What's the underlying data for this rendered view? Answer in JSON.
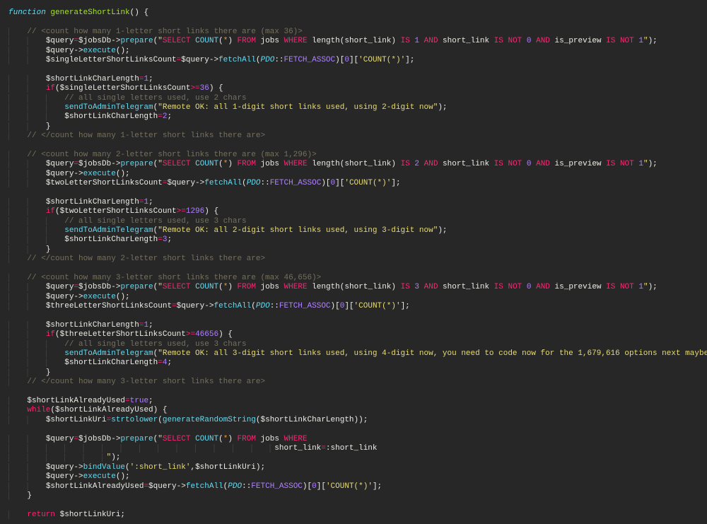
{
  "code": {
    "lines": [
      [
        [
          "i",
          "function"
        ],
        [
          "t",
          " "
        ],
        [
          "g",
          "generateShortLink"
        ],
        [
          "t",
          "() {"
        ]
      ],
      [],
      [
        [
          "ws",
          "    "
        ],
        [
          "m",
          "// <count how many 1-letter short links there are (max 36)>"
        ]
      ],
      [
        [
          "ws",
          "        "
        ],
        [
          "t",
          "$query"
        ],
        [
          "k",
          "="
        ],
        [
          "t",
          "$jobsDb->"
        ],
        [
          "c",
          "prepare"
        ],
        [
          "t",
          "("
        ],
        [
          "s",
          "\""
        ],
        [
          "k",
          "SELECT"
        ],
        [
          "t",
          " "
        ],
        [
          "c",
          "COUNT"
        ],
        [
          "t",
          "("
        ],
        [
          "o",
          "*"
        ],
        [
          "t",
          ") "
        ],
        [
          "k",
          "FROM"
        ],
        [
          "t",
          " jobs "
        ],
        [
          "k",
          "WHERE"
        ],
        [
          "t",
          " length(short_link) "
        ],
        [
          "k",
          "IS"
        ],
        [
          "t",
          " "
        ],
        [
          "n",
          "1"
        ],
        [
          "t",
          " "
        ],
        [
          "k",
          "AND"
        ],
        [
          "t",
          " short_link "
        ],
        [
          "k",
          "IS NOT"
        ],
        [
          "t",
          " "
        ],
        [
          "n",
          "0"
        ],
        [
          "t",
          " "
        ],
        [
          "k",
          "AND"
        ],
        [
          "t",
          " is_preview "
        ],
        [
          "k",
          "IS NOT"
        ],
        [
          "t",
          " "
        ],
        [
          "n",
          "1"
        ],
        [
          "s",
          "\""
        ],
        [
          "t",
          ");"
        ]
      ],
      [
        [
          "ws",
          "        "
        ],
        [
          "t",
          "$query->"
        ],
        [
          "c",
          "execute"
        ],
        [
          "t",
          "();"
        ]
      ],
      [
        [
          "ws",
          "        "
        ],
        [
          "t",
          "$singleLetterShortLinksCount"
        ],
        [
          "k",
          "="
        ],
        [
          "t",
          "$query->"
        ],
        [
          "c",
          "fetchAll"
        ],
        [
          "t",
          "("
        ],
        [
          "i",
          "PDO"
        ],
        [
          "t",
          "::"
        ],
        [
          "p",
          "FETCH_ASSOC"
        ],
        [
          "t",
          ")["
        ],
        [
          "n",
          "0"
        ],
        [
          "t",
          "]["
        ],
        [
          "s",
          "'COUNT(*)'"
        ],
        [
          "t",
          "];"
        ]
      ],
      [],
      [
        [
          "ws",
          "        "
        ],
        [
          "t",
          "$shortLinkCharLength"
        ],
        [
          "k",
          "="
        ],
        [
          "n",
          "1"
        ],
        [
          "t",
          ";"
        ]
      ],
      [
        [
          "ws",
          "        "
        ],
        [
          "k",
          "if"
        ],
        [
          "t",
          "($singleLetterShortLinksCount"
        ],
        [
          "k",
          ">="
        ],
        [
          "n",
          "36"
        ],
        [
          "t",
          ") {"
        ]
      ],
      [
        [
          "ws",
          "            "
        ],
        [
          "m",
          "// all single letters used, use 2 chars"
        ]
      ],
      [
        [
          "ws",
          "            "
        ],
        [
          "c",
          "sendToAdminTelegram"
        ],
        [
          "t",
          "("
        ],
        [
          "s",
          "\"Remote OK: all 1-digit short links used, using 2-digit now\""
        ],
        [
          "t",
          ");"
        ]
      ],
      [
        [
          "ws",
          "            "
        ],
        [
          "t",
          "$shortLinkCharLength"
        ],
        [
          "k",
          "="
        ],
        [
          "n",
          "2"
        ],
        [
          "t",
          ";"
        ]
      ],
      [
        [
          "ws",
          "        "
        ],
        [
          "t",
          "}"
        ]
      ],
      [
        [
          "ws",
          "    "
        ],
        [
          "m",
          "// </count how many 1-letter short links there are>"
        ]
      ],
      [],
      [
        [
          "ws",
          "    "
        ],
        [
          "m",
          "// <count how many 2-letter short links there are (max 1,296)>"
        ]
      ],
      [
        [
          "ws",
          "        "
        ],
        [
          "t",
          "$query"
        ],
        [
          "k",
          "="
        ],
        [
          "t",
          "$jobsDb->"
        ],
        [
          "c",
          "prepare"
        ],
        [
          "t",
          "("
        ],
        [
          "s",
          "\""
        ],
        [
          "k",
          "SELECT"
        ],
        [
          "t",
          " "
        ],
        [
          "c",
          "COUNT"
        ],
        [
          "t",
          "("
        ],
        [
          "o",
          "*"
        ],
        [
          "t",
          ") "
        ],
        [
          "k",
          "FROM"
        ],
        [
          "t",
          " jobs "
        ],
        [
          "k",
          "WHERE"
        ],
        [
          "t",
          " length(short_link) "
        ],
        [
          "k",
          "IS"
        ],
        [
          "t",
          " "
        ],
        [
          "n",
          "2"
        ],
        [
          "t",
          " "
        ],
        [
          "k",
          "AND"
        ],
        [
          "t",
          " short_link "
        ],
        [
          "k",
          "IS NOT"
        ],
        [
          "t",
          " "
        ],
        [
          "n",
          "0"
        ],
        [
          "t",
          " "
        ],
        [
          "k",
          "AND"
        ],
        [
          "t",
          " is_preview "
        ],
        [
          "k",
          "IS NOT"
        ],
        [
          "t",
          " "
        ],
        [
          "n",
          "1"
        ],
        [
          "s",
          "\""
        ],
        [
          "t",
          ");"
        ]
      ],
      [
        [
          "ws",
          "        "
        ],
        [
          "t",
          "$query->"
        ],
        [
          "c",
          "execute"
        ],
        [
          "t",
          "();"
        ]
      ],
      [
        [
          "ws",
          "        "
        ],
        [
          "t",
          "$twoLetterShortLinksCount"
        ],
        [
          "k",
          "="
        ],
        [
          "t",
          "$query->"
        ],
        [
          "c",
          "fetchAll"
        ],
        [
          "t",
          "("
        ],
        [
          "i",
          "PDO"
        ],
        [
          "t",
          "::"
        ],
        [
          "p",
          "FETCH_ASSOC"
        ],
        [
          "t",
          ")["
        ],
        [
          "n",
          "0"
        ],
        [
          "t",
          "]["
        ],
        [
          "s",
          "'COUNT(*)'"
        ],
        [
          "t",
          "];"
        ]
      ],
      [],
      [
        [
          "ws",
          "        "
        ],
        [
          "t",
          "$shortLinkCharLength"
        ],
        [
          "k",
          "="
        ],
        [
          "n",
          "1"
        ],
        [
          "t",
          ";"
        ]
      ],
      [
        [
          "ws",
          "        "
        ],
        [
          "k",
          "if"
        ],
        [
          "t",
          "($twoLetterShortLinksCount"
        ],
        [
          "k",
          ">="
        ],
        [
          "n",
          "1296"
        ],
        [
          "t",
          ") {"
        ]
      ],
      [
        [
          "ws",
          "            "
        ],
        [
          "m",
          "// all single letters used, use 3 chars"
        ]
      ],
      [
        [
          "ws",
          "            "
        ],
        [
          "c",
          "sendToAdminTelegram"
        ],
        [
          "t",
          "("
        ],
        [
          "s",
          "\"Remote OK: all 2-digit short links used, using 3-digit now\""
        ],
        [
          "t",
          ");"
        ]
      ],
      [
        [
          "ws",
          "            "
        ],
        [
          "t",
          "$shortLinkCharLength"
        ],
        [
          "k",
          "="
        ],
        [
          "n",
          "3"
        ],
        [
          "t",
          ";"
        ]
      ],
      [
        [
          "ws",
          "        "
        ],
        [
          "t",
          "}"
        ]
      ],
      [
        [
          "ws",
          "    "
        ],
        [
          "m",
          "// </count how many 2-letter short links there are>"
        ]
      ],
      [],
      [
        [
          "ws",
          "    "
        ],
        [
          "m",
          "// <count how many 3-letter short links there are (max 46,656)>"
        ]
      ],
      [
        [
          "ws",
          "        "
        ],
        [
          "t",
          "$query"
        ],
        [
          "k",
          "="
        ],
        [
          "t",
          "$jobsDb->"
        ],
        [
          "c",
          "prepare"
        ],
        [
          "t",
          "("
        ],
        [
          "s",
          "\""
        ],
        [
          "k",
          "SELECT"
        ],
        [
          "t",
          " "
        ],
        [
          "c",
          "COUNT"
        ],
        [
          "t",
          "("
        ],
        [
          "o",
          "*"
        ],
        [
          "t",
          ") "
        ],
        [
          "k",
          "FROM"
        ],
        [
          "t",
          " jobs "
        ],
        [
          "k",
          "WHERE"
        ],
        [
          "t",
          " length(short_link) "
        ],
        [
          "k",
          "IS"
        ],
        [
          "t",
          " "
        ],
        [
          "n",
          "3"
        ],
        [
          "t",
          " "
        ],
        [
          "k",
          "AND"
        ],
        [
          "t",
          " short_link "
        ],
        [
          "k",
          "IS NOT"
        ],
        [
          "t",
          " "
        ],
        [
          "n",
          "0"
        ],
        [
          "t",
          " "
        ],
        [
          "k",
          "AND"
        ],
        [
          "t",
          " is_preview "
        ],
        [
          "k",
          "IS NOT"
        ],
        [
          "t",
          " "
        ],
        [
          "n",
          "1"
        ],
        [
          "s",
          "\""
        ],
        [
          "t",
          ");"
        ]
      ],
      [
        [
          "ws",
          "        "
        ],
        [
          "t",
          "$query->"
        ],
        [
          "c",
          "execute"
        ],
        [
          "t",
          "();"
        ]
      ],
      [
        [
          "ws",
          "        "
        ],
        [
          "t",
          "$threeLetterShortLinksCount"
        ],
        [
          "k",
          "="
        ],
        [
          "t",
          "$query->"
        ],
        [
          "c",
          "fetchAll"
        ],
        [
          "t",
          "("
        ],
        [
          "i",
          "PDO"
        ],
        [
          "t",
          "::"
        ],
        [
          "p",
          "FETCH_ASSOC"
        ],
        [
          "t",
          ")["
        ],
        [
          "n",
          "0"
        ],
        [
          "t",
          "]["
        ],
        [
          "s",
          "'COUNT(*)'"
        ],
        [
          "t",
          "];"
        ]
      ],
      [],
      [
        [
          "ws",
          "        "
        ],
        [
          "t",
          "$shortLinkCharLength"
        ],
        [
          "k",
          "="
        ],
        [
          "n",
          "1"
        ],
        [
          "t",
          ";"
        ]
      ],
      [
        [
          "ws",
          "        "
        ],
        [
          "k",
          "if"
        ],
        [
          "t",
          "($threeLetterShortLinksCount"
        ],
        [
          "k",
          ">="
        ],
        [
          "n",
          "46656"
        ],
        [
          "t",
          ") {"
        ]
      ],
      [
        [
          "ws",
          "            "
        ],
        [
          "m",
          "// all single letters used, use 3 chars"
        ]
      ],
      [
        [
          "ws",
          "            "
        ],
        [
          "c",
          "sendToAdminTelegram"
        ],
        [
          "t",
          "("
        ],
        [
          "s",
          "\"Remote OK: all 3-digit short links used, using 4-digit now, you need to code now for the 1,679,616 options next maybe\""
        ],
        [
          "t",
          ");"
        ]
      ],
      [
        [
          "ws",
          "            "
        ],
        [
          "t",
          "$shortLinkCharLength"
        ],
        [
          "k",
          "="
        ],
        [
          "n",
          "4"
        ],
        [
          "t",
          ";"
        ]
      ],
      [
        [
          "ws",
          "        "
        ],
        [
          "t",
          "}"
        ]
      ],
      [
        [
          "ws",
          "    "
        ],
        [
          "m",
          "// </count how many 3-letter short links there are>"
        ]
      ],
      [],
      [
        [
          "ws",
          "    "
        ],
        [
          "t",
          "$shortLinkAlreadyUsed"
        ],
        [
          "k",
          "="
        ],
        [
          "n",
          "true"
        ],
        [
          "t",
          ";"
        ]
      ],
      [
        [
          "ws",
          "    "
        ],
        [
          "k",
          "while"
        ],
        [
          "t",
          "($shortLinkAlreadyUsed) {"
        ]
      ],
      [
        [
          "ws",
          "        "
        ],
        [
          "t",
          "$shortLinkUri"
        ],
        [
          "k",
          "="
        ],
        [
          "c",
          "strtolower"
        ],
        [
          "t",
          "("
        ],
        [
          "c",
          "generateRandomString"
        ],
        [
          "t",
          "($shortLinkCharLength));"
        ]
      ],
      [],
      [
        [
          "ws",
          "        "
        ],
        [
          "t",
          "$query"
        ],
        [
          "k",
          "="
        ],
        [
          "t",
          "$jobsDb->"
        ],
        [
          "c",
          "prepare"
        ],
        [
          "t",
          "("
        ],
        [
          "s",
          "\""
        ],
        [
          "k",
          "SELECT"
        ],
        [
          "t",
          " "
        ],
        [
          "c",
          "COUNT"
        ],
        [
          "t",
          "("
        ],
        [
          "o",
          "*"
        ],
        [
          "t",
          ") "
        ],
        [
          "k",
          "FROM"
        ],
        [
          "t",
          " jobs "
        ],
        [
          "k",
          "WHERE"
        ]
      ],
      [
        [
          "ws",
          "                                                         "
        ],
        [
          "t",
          "short_link"
        ],
        [
          "k",
          "="
        ],
        [
          "t",
          ":short_link"
        ]
      ],
      [
        [
          "ws",
          "                     "
        ],
        [
          "s",
          "\""
        ],
        [
          "t",
          ");"
        ]
      ],
      [
        [
          "ws",
          "        "
        ],
        [
          "t",
          "$query->"
        ],
        [
          "c",
          "bindValue"
        ],
        [
          "t",
          "("
        ],
        [
          "s",
          "':short_link'"
        ],
        [
          "t",
          ",$shortLinkUri);"
        ]
      ],
      [
        [
          "ws",
          "        "
        ],
        [
          "t",
          "$query->"
        ],
        [
          "c",
          "execute"
        ],
        [
          "t",
          "();"
        ]
      ],
      [
        [
          "ws",
          "        "
        ],
        [
          "t",
          "$shortLinkAlreadyUsed"
        ],
        [
          "k",
          "="
        ],
        [
          "t",
          "$query->"
        ],
        [
          "c",
          "fetchAll"
        ],
        [
          "t",
          "("
        ],
        [
          "i",
          "PDO"
        ],
        [
          "t",
          "::"
        ],
        [
          "p",
          "FETCH_ASSOC"
        ],
        [
          "t",
          ")["
        ],
        [
          "n",
          "0"
        ],
        [
          "t",
          "]["
        ],
        [
          "s",
          "'COUNT(*)'"
        ],
        [
          "t",
          "];"
        ]
      ],
      [
        [
          "ws",
          "    "
        ],
        [
          "t",
          "}"
        ]
      ],
      [],
      [
        [
          "ws",
          "    "
        ],
        [
          "k",
          "return"
        ],
        [
          "t",
          " $shortLinkUri;"
        ]
      ]
    ]
  },
  "colors": {
    "background": "#272727",
    "keyword": "#f92672",
    "function": "#66d9ef",
    "string": "#e6db74",
    "number": "#ae81ff",
    "comment": "#75715e",
    "name": "#a6e22e"
  }
}
